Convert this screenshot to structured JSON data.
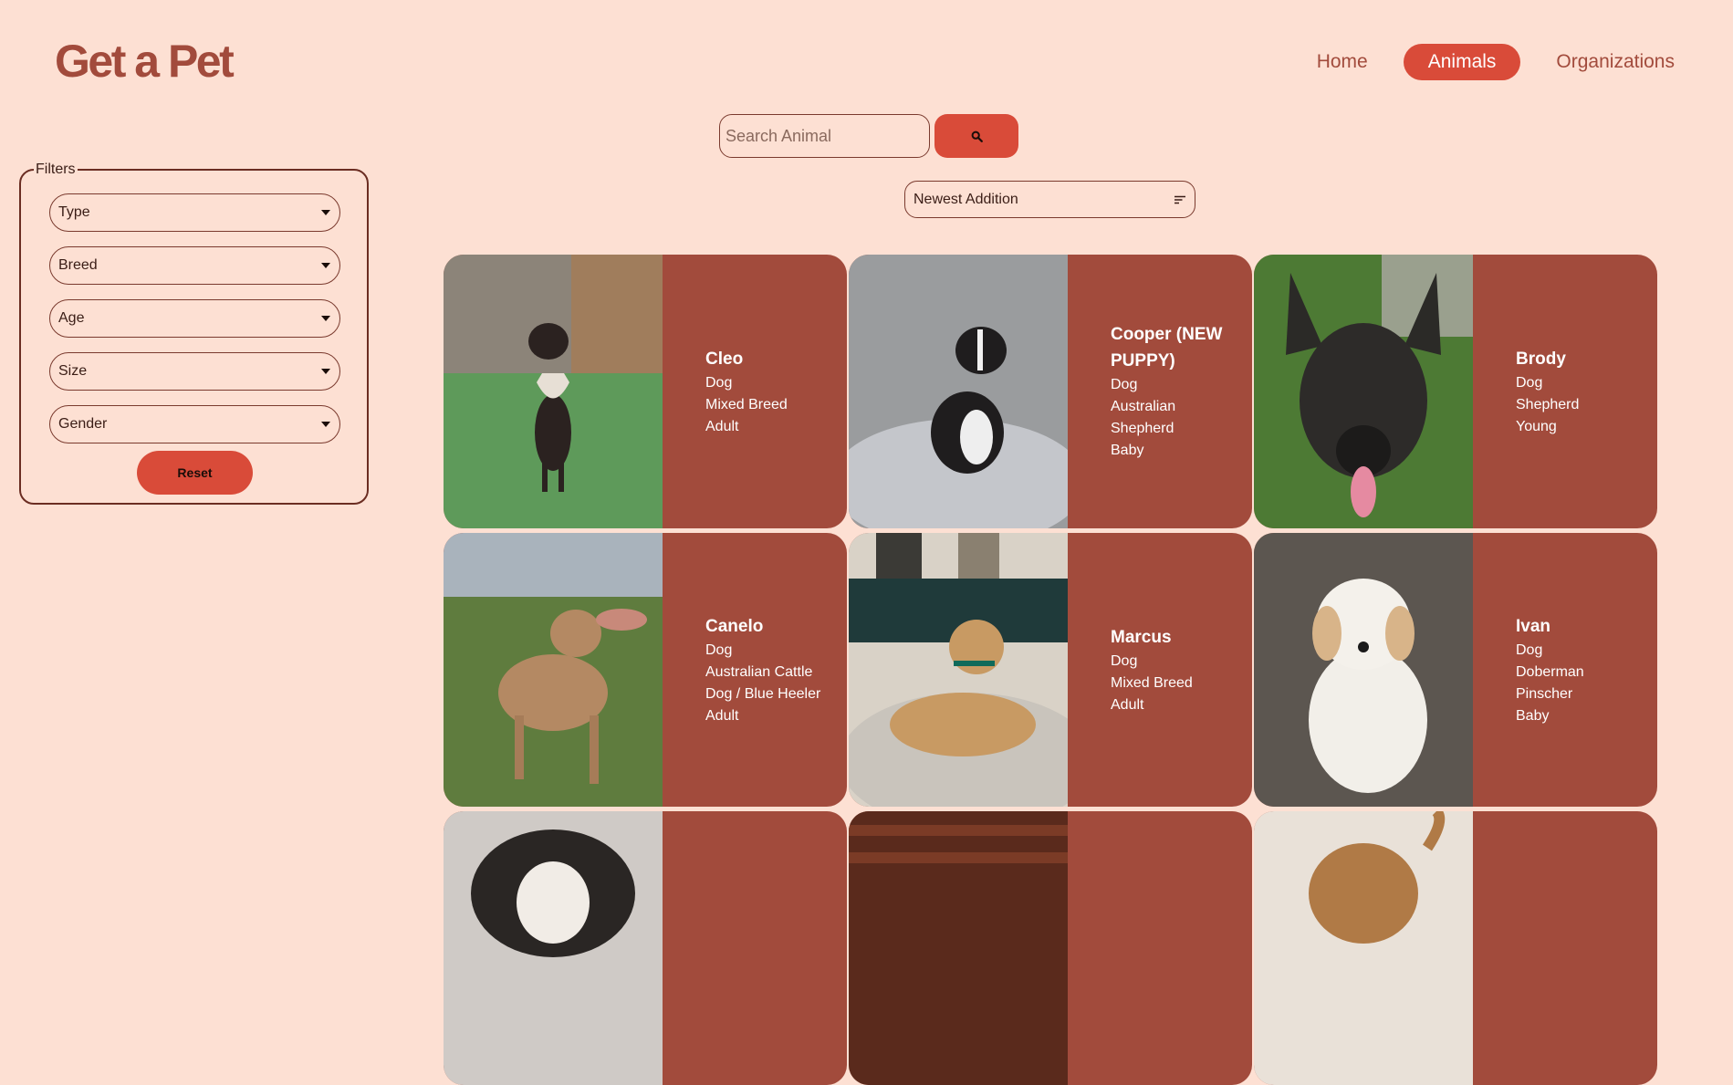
{
  "header": {
    "logo": "Get a Pet",
    "nav": [
      {
        "label": "Home",
        "active": false
      },
      {
        "label": "Animals",
        "active": true
      },
      {
        "label": "Organizations",
        "active": false
      }
    ]
  },
  "search": {
    "placeholder": "Search Animal",
    "value": "",
    "button_icon": "search-icon"
  },
  "sort": {
    "selected": "Newest Addition",
    "icon": "sort-icon"
  },
  "filters": {
    "legend": "Filters",
    "selects": [
      "Type",
      "Breed",
      "Age",
      "Size",
      "Gender"
    ],
    "reset_label": "Reset"
  },
  "animals": [
    {
      "name": "Cleo",
      "type": "Dog",
      "breed": "Mixed Breed",
      "age": "Adult"
    },
    {
      "name": "Cooper (NEW PUPPY)",
      "type": "Dog",
      "breed": "Australian Shepherd",
      "age": "Baby"
    },
    {
      "name": "Brody",
      "type": "Dog",
      "breed": "Shepherd",
      "age": "Young"
    },
    {
      "name": "Canelo",
      "type": "Dog",
      "breed": "Australian Cattle Dog / Blue Heeler",
      "age": "Adult"
    },
    {
      "name": "Marcus",
      "type": "Dog",
      "breed": "Mixed Breed",
      "age": "Adult"
    },
    {
      "name": "Ivan",
      "type": "Dog",
      "breed": "Doberman Pinscher",
      "age": "Baby"
    }
  ],
  "colors": {
    "background": "#fde0d3",
    "accent": "#d94b39",
    "card": "#a24b3c",
    "logo": "#a24b3c"
  }
}
